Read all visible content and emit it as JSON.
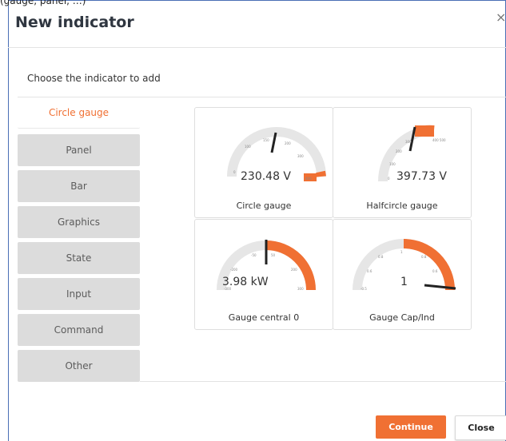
{
  "caption_fragment": "(gauge, panel, …)",
  "dialog": {
    "title": "New indicator",
    "close_symbol": "×",
    "prompt": "Choose the indicator to add"
  },
  "categories": [
    {
      "label": "Circle gauge",
      "active": true
    },
    {
      "label": "Panel",
      "active": false
    },
    {
      "label": "Bar",
      "active": false
    },
    {
      "label": "Graphics",
      "active": false
    },
    {
      "label": "State",
      "active": false
    },
    {
      "label": "Input",
      "active": false
    },
    {
      "label": "Command",
      "active": false
    },
    {
      "label": "Other",
      "active": false
    }
  ],
  "cards": [
    {
      "label": "Circle gauge",
      "value": "230.48 V"
    },
    {
      "label": "Halfcircle gauge",
      "value": "397.73 V"
    },
    {
      "label": "Gauge central 0",
      "value": "3.98 kW"
    },
    {
      "label": "Gauge Cap/Ind",
      "value": "1"
    }
  ],
  "buttons": {
    "continue": "Continue",
    "close": "Close"
  },
  "colors": {
    "accent": "#f07033",
    "track": "#e6e6e6",
    "needle": "#222222",
    "inactive_tab": "#dcdcdc"
  }
}
